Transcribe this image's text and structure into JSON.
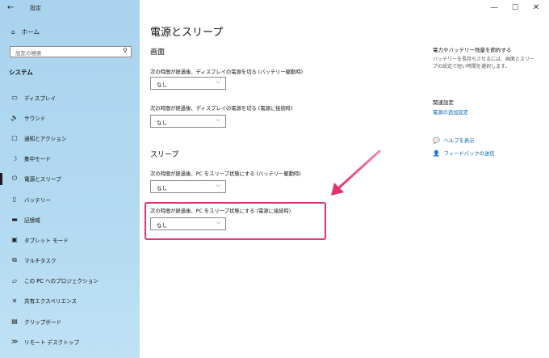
{
  "window": {
    "title": "設定",
    "back_icon": "←",
    "minimize_icon": "—",
    "maximize_icon": "☐",
    "close_icon": "✕"
  },
  "sidebar": {
    "home_label": "ホーム",
    "search_placeholder": "設定の検索",
    "section_label": "システム",
    "items": [
      {
        "label": "ディスプレイ",
        "icon": "▭"
      },
      {
        "label": "サウンド",
        "icon": "🔈"
      },
      {
        "label": "通知とアクション",
        "icon": "▢"
      },
      {
        "label": "集中モード",
        "icon": "☽"
      },
      {
        "label": "電源とスリープ",
        "icon": "⏻",
        "active": true
      },
      {
        "label": "バッテリー",
        "icon": "▯"
      },
      {
        "label": "記憶域",
        "icon": "▬"
      },
      {
        "label": "タブレット モード",
        "icon": "▣"
      },
      {
        "label": "マルチタスク",
        "icon": "⧉"
      },
      {
        "label": "この PC へのプロジェクション",
        "icon": "▱"
      },
      {
        "label": "共有エクスペリエンス",
        "icon": "✕"
      },
      {
        "label": "クリップボード",
        "icon": "▤"
      },
      {
        "label": "リモート デスクトップ",
        "icon": "≫"
      }
    ]
  },
  "main": {
    "title": "電源とスリープ",
    "screen_heading": "画面",
    "screen_battery_label": "次の時間が経過後、ディスプレイの電源を切る (バッテリー駆動時)",
    "screen_battery_value": "なし",
    "screen_plugged_label": "次の時間が経過後、ディスプレイの電源を切る (電源に接続時)",
    "screen_plugged_value": "なし",
    "sleep_heading": "スリープ",
    "sleep_battery_label": "次の時間が経過後、PC をスリープ状態にする (バッテリー駆動時)",
    "sleep_battery_value": "なし",
    "sleep_plugged_label": "次の時間が経過後、PC をスリープ状態にする (電源に接続時)",
    "sleep_plugged_value": "なし",
    "chevron": "⌵"
  },
  "right_panel": {
    "save_heading": "電力やバッテリー残量を節約する",
    "save_text": "バッテリーを長持ちさせるには、画面とスリープの設定で短い時間を選択します。",
    "related_heading": "関連設定",
    "related_link": "電源の追加設定",
    "help_label": "ヘルプを表示",
    "feedback_label": "フィードバックの送信"
  },
  "colors": {
    "sidebar": "#b3daf1",
    "accent_link": "#0063b1",
    "highlight": "#e0336a"
  }
}
